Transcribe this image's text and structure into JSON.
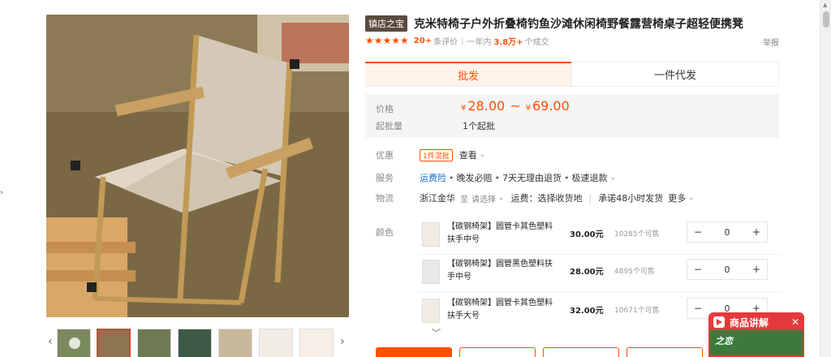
{
  "gallery": {
    "prev_arrow": "‹",
    "next_arrow": "›"
  },
  "product": {
    "shop_tag": "镇店之宝",
    "title": "克米特椅子户外折叠椅钓鱼沙滩休闲椅野餐露营椅桌子超轻便携凳",
    "stars": "★★★★★",
    "review_count": "20+",
    "review_label": "条评价",
    "sales_prefix": "一年内",
    "sales_count": "3.8万+",
    "sales_label": "个成交",
    "report": "举报"
  },
  "tabs": [
    {
      "label": "批发",
      "active": true
    },
    {
      "label": "一件代发",
      "active": false
    }
  ],
  "pricing": {
    "price_label": "价格",
    "currency": "¥",
    "price_min": "28.00",
    "range_sep": "~",
    "price_max": "69.00",
    "moq_label": "起批量",
    "moq_value": "1个起批"
  },
  "details": {
    "promo_label": "优惠",
    "promo_badge": "1件混批",
    "promo_link": "查看",
    "service_label": "服务",
    "service_items": [
      "运费险",
      "晚发必赔",
      "7天无理由退货",
      "极速退款"
    ],
    "logistics_label": "物流",
    "origin": "浙江金华",
    "to": "至",
    "dest_placeholder": "请选择",
    "shipping": "运费：选择收货地",
    "commitment": "承诺48小时发货",
    "more": "更多"
  },
  "variants": {
    "label": "颜色",
    "items": [
      {
        "name": "【碳钢椅架】圆管卡其色塑料扶手中号",
        "price": "30.00元",
        "stock": "10285个可售",
        "qty": "0"
      },
      {
        "name": "【碳钢椅架】圆管黑色塑料扶手中号",
        "price": "28.00元",
        "stock": "4895个可售",
        "qty": "0"
      },
      {
        "name": "【碳钢椅架】圆管卡其色塑料扶手大号",
        "price": "32.00元",
        "stock": "10671个可售",
        "qty": "0"
      }
    ],
    "minus": "−",
    "plus": "+",
    "expand": "﹀"
  },
  "float_widget": {
    "title": "商品讲解",
    "close": "✕",
    "brand": "之恋"
  },
  "colors": {
    "accent": "#ff5000",
    "red": "#e4393c",
    "link": "#1a6fd6"
  }
}
